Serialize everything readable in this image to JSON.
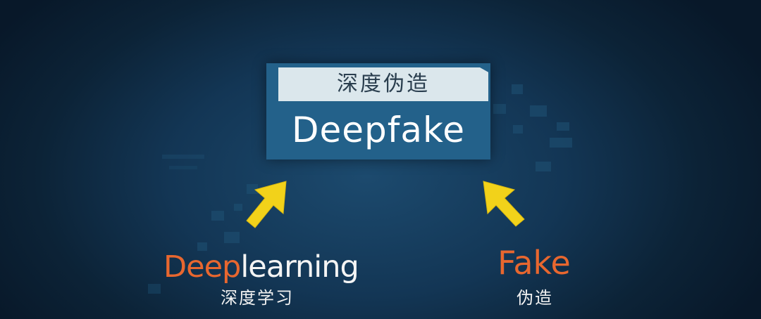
{
  "center": {
    "title_cn": "深度伪造",
    "title_en": "Deepfake"
  },
  "left": {
    "word_highlight": "Deep",
    "word_rest": "learning",
    "subtitle": "深度学习"
  },
  "right": {
    "word": "Fake",
    "subtitle": "伪造"
  },
  "colors": {
    "accent_orange": "#e8672f",
    "arrow_yellow": "#f2d21a",
    "box_blue": "#23618a",
    "box_light": "#dbe7ec"
  }
}
